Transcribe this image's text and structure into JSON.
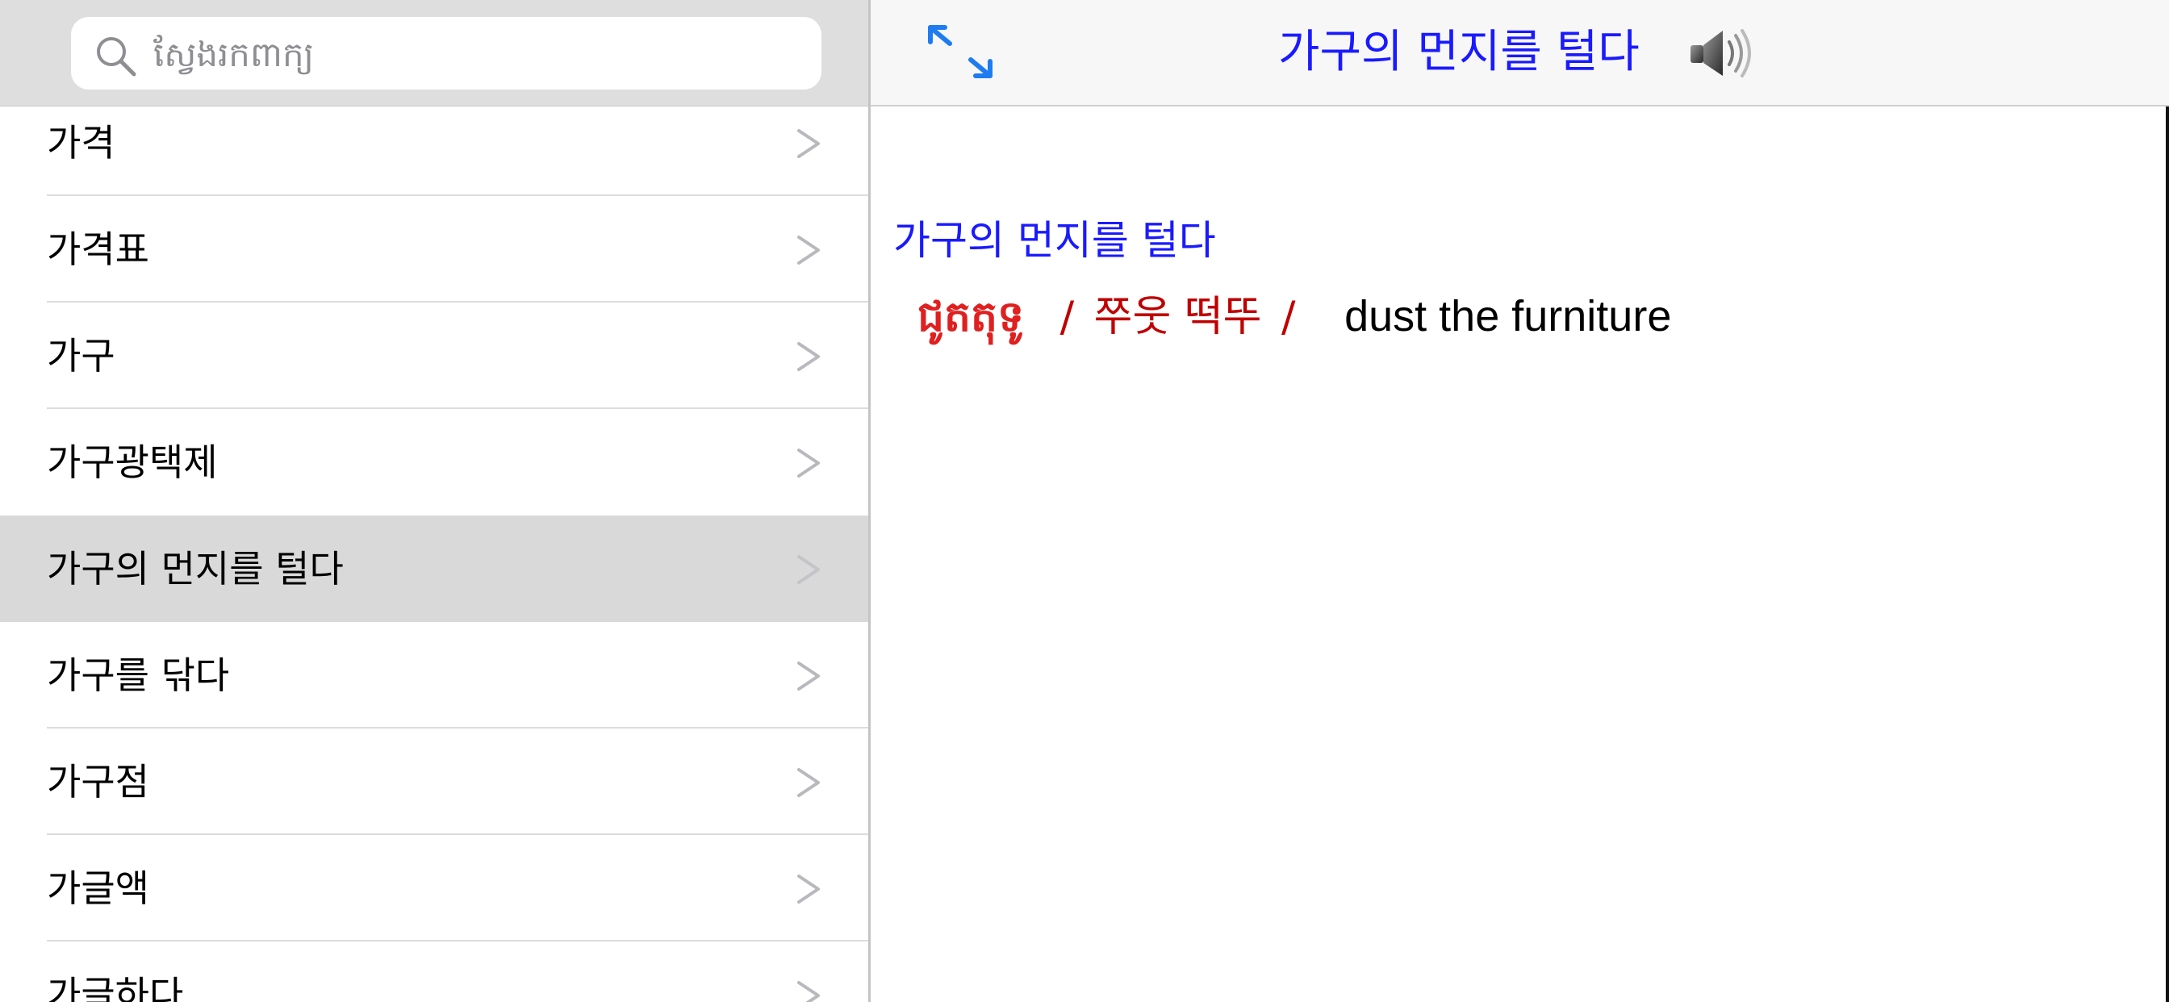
{
  "search": {
    "placeholder": "ស្វែងរកពាក្យ"
  },
  "word_list": {
    "items": [
      {
        "label": "가격"
      },
      {
        "label": "가격표"
      },
      {
        "label": "가구"
      },
      {
        "label": "가구광택제"
      },
      {
        "label": "가구의 먼지를 털다",
        "selected": true
      },
      {
        "label": "가구를 닦다"
      },
      {
        "label": "가구점"
      },
      {
        "label": "가글액"
      },
      {
        "label": "가글하다"
      }
    ]
  },
  "detail": {
    "title": "가구의 먼지를 털다",
    "entry": {
      "headword": "가구의 먼지를 털다",
      "khmer": "ជូតតុទូ",
      "separator": "/",
      "pronunciation": "쭈웃 떡뚜",
      "english": "dust the furniture"
    }
  },
  "icons": {
    "search": "search-icon",
    "chevron": "chevron-right-icon",
    "expand": "expand-arrows-icon",
    "speaker": "speaker-icon"
  },
  "colors": {
    "accent_blue": "#1a1aff",
    "icon_blue": "#1e7cf0",
    "khmer_red": "#e02020",
    "pronunciation_red": "#c00000",
    "selected_row": "#d9d9d9",
    "search_bar_bg": "#dedede"
  }
}
